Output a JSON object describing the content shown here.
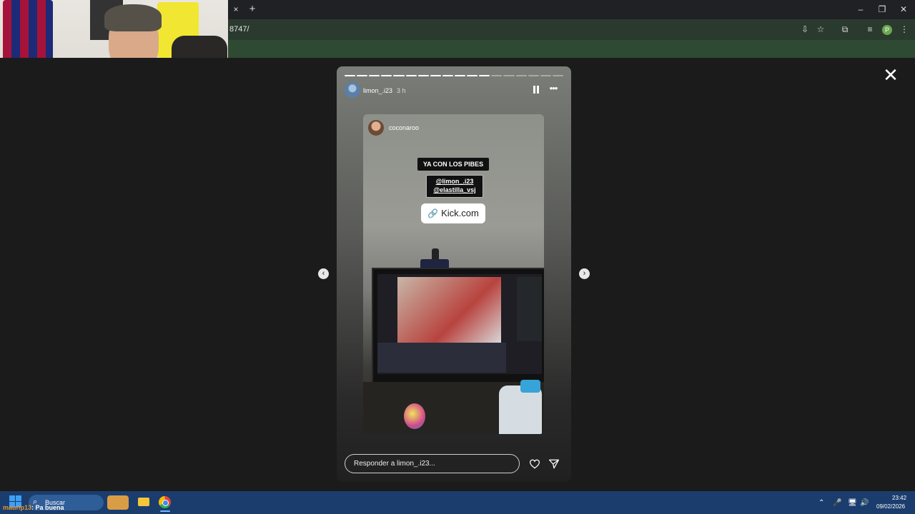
{
  "browser": {
    "tab_close": "×",
    "new_tab": "+",
    "url": "8747/",
    "profile_initial": "P",
    "window_buttons": [
      "–",
      "❐",
      "✕"
    ]
  },
  "viewer": {
    "close": "✕",
    "prev": "‹",
    "next": "›"
  },
  "story": {
    "segments_total": 18,
    "segments_done": 12,
    "username": "limon_.i23",
    "time": "3 h",
    "more": "•••",
    "inner_username": "coconaroo",
    "sticker_text": "YA CON LOS PIBES",
    "mentions": [
      "@limon_.i23",
      "@elastilla_vsj"
    ],
    "link_text": "Kick.com",
    "link_icon": "🔗",
    "reply_placeholder": "Responder a limon_.i23..."
  },
  "taskbar": {
    "search_label": "Buscar",
    "search_icon": "⌕",
    "chat_user": "maurip13",
    "chat_sep": ":",
    "chat_message": "Pa buena",
    "time": "23:42",
    "date": "09/02/2026",
    "tray_icons": [
      "⌃",
      "🎤",
      "🖥",
      "🔊"
    ]
  },
  "colors": {
    "taskbar": "#1a3d6e",
    "browser_frame": "#202124",
    "toolbar": "#2b3a2e",
    "chat_user": "#e79528"
  }
}
